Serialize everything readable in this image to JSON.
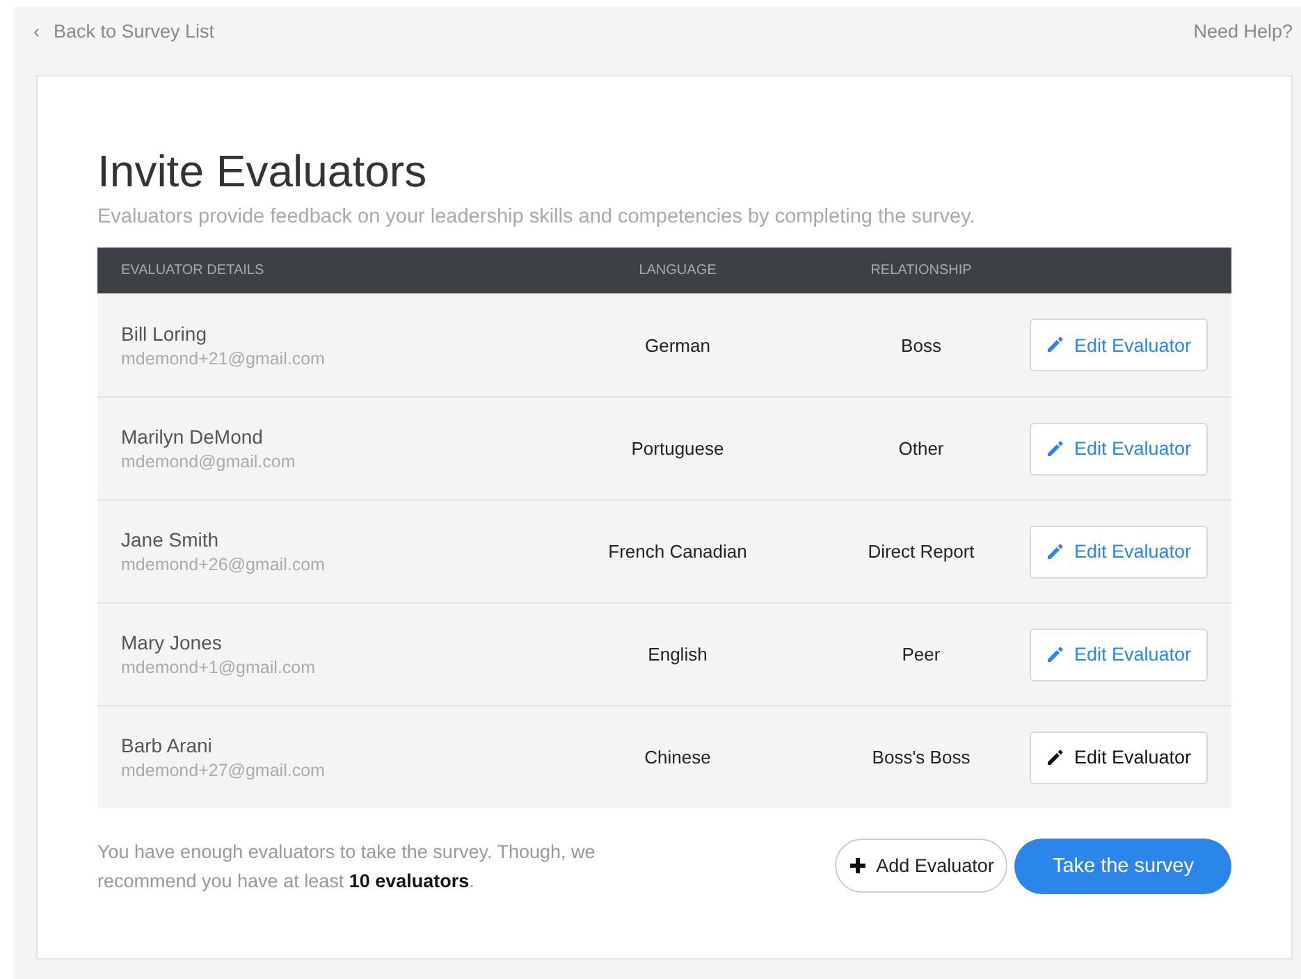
{
  "top_bar": {
    "back_icon": "‹",
    "back_link": "Back to Survey List",
    "help_link": "Need Help?"
  },
  "title": "Invite Evaluators",
  "subtitle": "Evaluators provide feedback on your leadership skills and competencies by completing the survey.",
  "table": {
    "columns": [
      "EVALUATOR DETAILS",
      "LANGUAGE",
      "RELATIONSHIP"
    ],
    "rows": [
      {
        "name": "Bill Loring",
        "email": "mdemond+21@gmail.com",
        "language": "German",
        "relationship": "Boss",
        "action": "Edit Evaluator",
        "hovered": false
      },
      {
        "name": "Marilyn DeMond",
        "email": "mdemond@gmail.com",
        "language": "Portuguese",
        "relationship": "Other",
        "action": "Edit Evaluator",
        "hovered": false
      },
      {
        "name": "Jane Smith",
        "email": "mdemond+26@gmail.com",
        "language": "French Canadian",
        "relationship": "Direct Report",
        "action": "Edit Evaluator",
        "hovered": false
      },
      {
        "name": "Mary Jones",
        "email": "mdemond+1@gmail.com",
        "language": "English",
        "relationship": "Peer",
        "action": "Edit Evaluator",
        "hovered": false
      },
      {
        "name": "Barb Arani",
        "email": "mdemond+27@gmail.com",
        "language": "Chinese",
        "relationship": "Boss's Boss",
        "action": "Edit Evaluator",
        "hovered": true
      }
    ]
  },
  "footer": {
    "note": "You have enough evaluators to take the survey. Though, we recommend you have at least **10 evaluators**.",
    "add_button": "Add Evaluator",
    "primary_button": "Take the survey"
  }
}
